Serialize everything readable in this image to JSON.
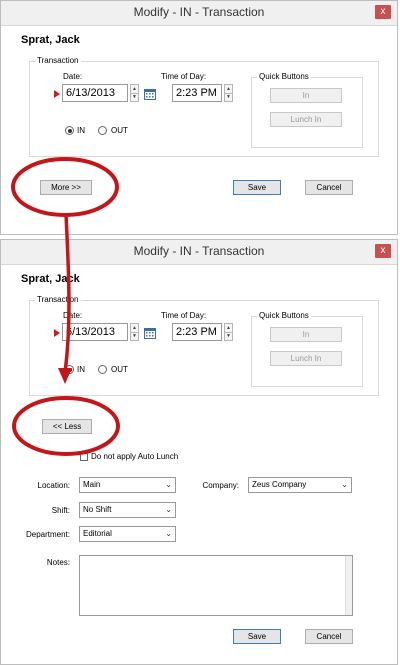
{
  "colors": {
    "annotation_red": "#c41618",
    "marker_red": "#d11a1a"
  },
  "window1": {
    "title": "Modify - IN - Transaction",
    "close_glyph": "x",
    "employee_name": "Sprat, Jack",
    "transaction": {
      "legend": "Transaction",
      "date_label": "Date:",
      "date_value": "6/13/2013",
      "time_label": "Time of Day:",
      "time_value": "2:23 PM",
      "radio_in_label": "IN",
      "radio_out_label": "OUT",
      "selected": "IN"
    },
    "quick_buttons": {
      "legend": "Quick Buttons",
      "in_label": "In",
      "lunch_in_label": "Lunch In"
    },
    "more_label": "More >>",
    "save_label": "Save",
    "cancel_label": "Cancel"
  },
  "window2": {
    "title": "Modify - IN - Transaction",
    "close_glyph": "x",
    "employee_name": "Sprat, Jack",
    "transaction": {
      "legend": "Transaction",
      "date_label": "Date:",
      "date_value": "6/13/2013",
      "time_label": "Time of Day:",
      "time_value": "2:23 PM",
      "radio_in_label": "IN",
      "radio_out_label": "OUT",
      "selected": "IN"
    },
    "quick_buttons": {
      "legend": "Quick Buttons",
      "in_label": "In",
      "lunch_in_label": "Lunch In"
    },
    "less_label": "<< Less",
    "auto_lunch_label": "Do not apply Auto Lunch",
    "location_label": "Location:",
    "location_value": "Main",
    "company_label": "Company:",
    "company_value": "Zeus Company",
    "shift_label": "Shift:",
    "shift_value": "No Shift",
    "department_label": "Department:",
    "department_value": "Editorial",
    "notes_label": "Notes:",
    "save_label": "Save",
    "cancel_label": "Cancel"
  },
  "icons": {
    "close": "close-icon",
    "calendar": "calendar-icon",
    "dropdown": "chevron-down-icon",
    "spin_up": "spin-up-icon",
    "spin_down": "spin-down-icon",
    "required": "required-arrow-icon"
  }
}
